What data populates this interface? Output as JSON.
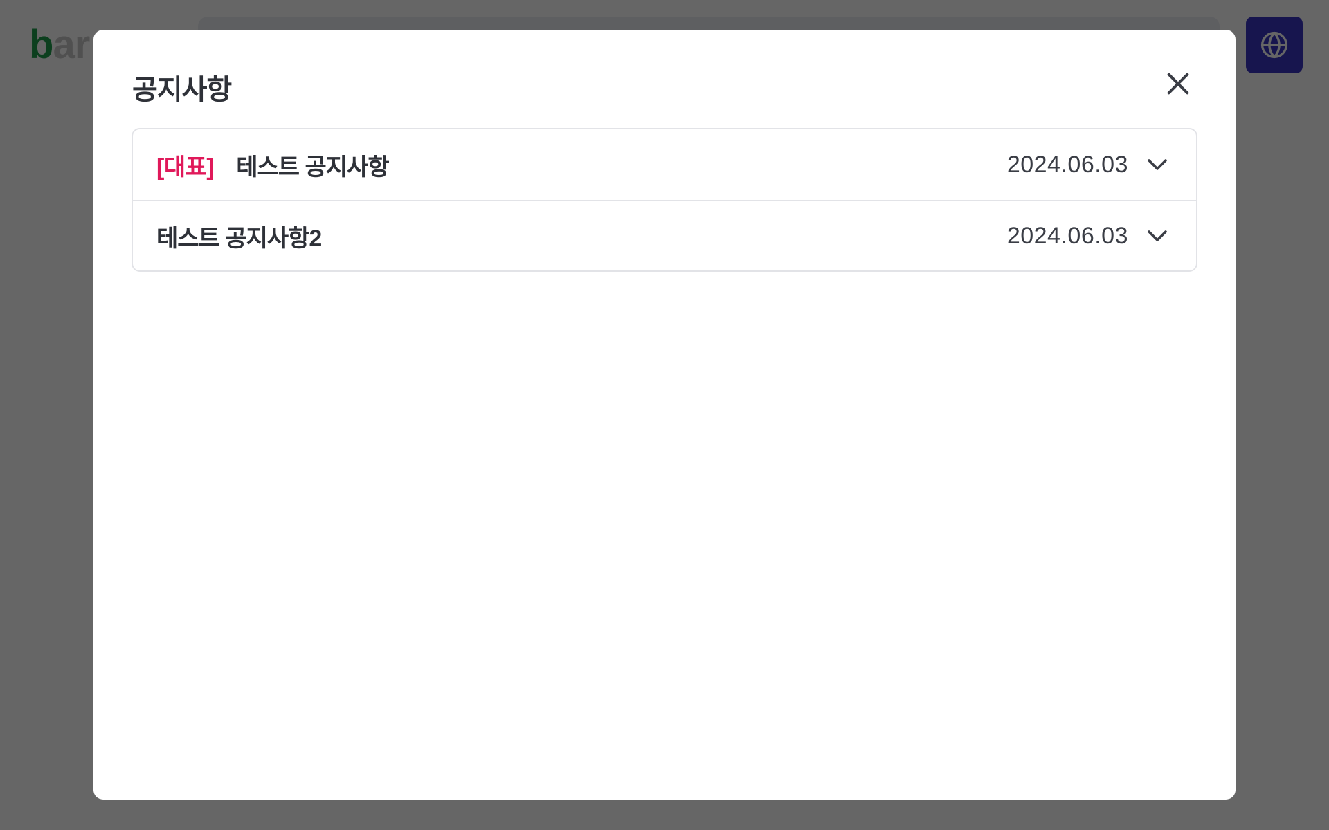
{
  "app": {
    "logo_first_letter": "b",
    "logo_rest": "ar"
  },
  "header": {
    "globe_icon": "globe-icon",
    "globe_color": "#3b35c4"
  },
  "modal": {
    "title": "공지사항",
    "close_icon": "close-icon",
    "notices": [
      {
        "badge": "[대표]",
        "title": "테스트 공지사항",
        "date": "2024.06.03",
        "icon": "chevron-down-icon"
      },
      {
        "badge": "",
        "title": "테스트 공지사항2",
        "date": "2024.06.03",
        "icon": "chevron-down-icon"
      }
    ]
  },
  "colors": {
    "badge": "#e0195a",
    "brand_green": "#1f9d4c",
    "overlay": "rgba(0,0,0,0.6)"
  }
}
